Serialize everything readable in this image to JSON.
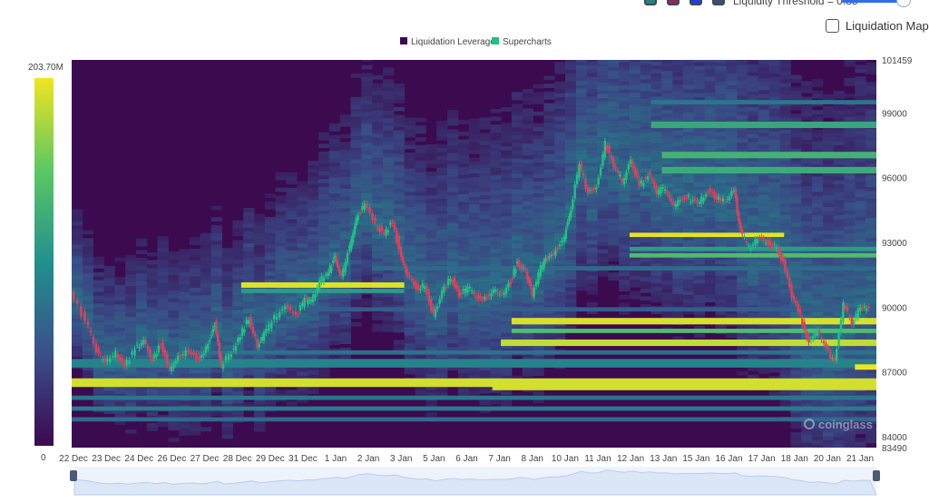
{
  "controls": {
    "threshold_label": "Liquidity Threshold = 0.85",
    "threshold_value": 0.85,
    "swatch_colors": [
      "#2f7f7a",
      "#8c2a5a",
      "#1f3fd8",
      "#3d4f6a"
    ],
    "liquidation_map_label": "Liquidation Map",
    "liquidation_map_checked": false
  },
  "chart_data": {
    "type": "heatmap",
    "legend": [
      {
        "name": "Liquidation Leverage",
        "color": "#3b0a4f"
      },
      {
        "name": "Supercharts",
        "color": "#22c184"
      }
    ],
    "colorbar": {
      "max_label": "203.70M",
      "min_label": "0",
      "max": 203700000,
      "min": 0,
      "colors": [
        "#3b0a4f",
        "#3a4f8a",
        "#21908d",
        "#5cc863",
        "#f0e51f"
      ]
    },
    "x_labels": [
      "22 Dec",
      "23 Dec",
      "24 Dec",
      "26 Dec",
      "27 Dec",
      "28 Dec",
      "29 Dec",
      "31 Dec",
      "1 Jan",
      "2 Jan",
      "3 Jan",
      "5 Jan",
      "6 Jan",
      "7 Jan",
      "8 Jan",
      "10 Jan",
      "11 Jan",
      "12 Jan",
      "13 Jan",
      "15 Jan",
      "16 Jan",
      "17 Jan",
      "18 Jan",
      "20 Jan",
      "21 Jan"
    ],
    "y_ticks": [
      99000,
      96000,
      93000,
      90000,
      87000,
      84000
    ],
    "y_max_label": "101459",
    "y_min_label": "83490",
    "ylim": [
      83490,
      101459
    ],
    "background_color": "#3b0a4f",
    "price_path": [
      [
        0,
        90600
      ],
      [
        0.7,
        89400
      ],
      [
        1.2,
        88000
      ],
      [
        1.6,
        87400
      ],
      [
        2.1,
        87900
      ],
      [
        2.5,
        87200
      ],
      [
        3.0,
        88100
      ],
      [
        3.4,
        88400
      ],
      [
        3.8,
        87600
      ],
      [
        4.2,
        88300
      ],
      [
        4.6,
        87100
      ],
      [
        5.0,
        87700
      ],
      [
        5.5,
        88000
      ],
      [
        6.0,
        87500
      ],
      [
        6.4,
        88300
      ],
      [
        6.7,
        89300
      ],
      [
        7.0,
        87300
      ],
      [
        7.5,
        87900
      ],
      [
        7.9,
        88700
      ],
      [
        8.3,
        89500
      ],
      [
        8.7,
        88200
      ],
      [
        9.0,
        88700
      ],
      [
        9.5,
        89500
      ],
      [
        10.0,
        90100
      ],
      [
        10.5,
        89600
      ],
      [
        10.9,
        90300
      ],
      [
        11.2,
        90200
      ],
      [
        11.6,
        91200
      ],
      [
        12.0,
        91600
      ],
      [
        12.3,
        92300
      ],
      [
        12.6,
        91400
      ],
      [
        13.0,
        92800
      ],
      [
        13.3,
        94100
      ],
      [
        13.7,
        94800
      ],
      [
        14.2,
        93800
      ],
      [
        14.6,
        93400
      ],
      [
        15.0,
        94000
      ],
      [
        15.4,
        92300
      ],
      [
        15.7,
        91500
      ],
      [
        16.1,
        90900
      ],
      [
        16.5,
        91000
      ],
      [
        16.9,
        89600
      ],
      [
        17.3,
        90700
      ],
      [
        17.7,
        91400
      ],
      [
        18.1,
        90600
      ],
      [
        18.5,
        90900
      ],
      [
        18.9,
        90500
      ],
      [
        19.3,
        90400
      ],
      [
        19.7,
        90700
      ],
      [
        20.1,
        90600
      ],
      [
        20.5,
        91200
      ],
      [
        20.8,
        92100
      ],
      [
        21.2,
        91600
      ],
      [
        21.5,
        90600
      ],
      [
        21.9,
        91800
      ],
      [
        22.2,
        92300
      ],
      [
        22.6,
        92600
      ],
      [
        23.0,
        93300
      ],
      [
        23.3,
        94600
      ],
      [
        23.7,
        96600
      ],
      [
        24.1,
        95300
      ],
      [
        24.5,
        95600
      ],
      [
        24.9,
        97600
      ],
      [
        25.3,
        96600
      ],
      [
        25.7,
        95800
      ],
      [
        26.1,
        96800
      ],
      [
        26.5,
        95600
      ],
      [
        26.9,
        96200
      ],
      [
        27.3,
        95300
      ],
      [
        27.7,
        95500
      ],
      [
        28.1,
        94700
      ],
      [
        28.5,
        95100
      ],
      [
        28.9,
        95000
      ],
      [
        29.3,
        94900
      ],
      [
        29.7,
        95400
      ],
      [
        30.1,
        95100
      ],
      [
        30.5,
        94900
      ],
      [
        30.9,
        95500
      ],
      [
        31.2,
        93500
      ],
      [
        31.6,
        92800
      ],
      [
        32.0,
        93200
      ],
      [
        32.4,
        93000
      ],
      [
        32.8,
        92800
      ],
      [
        33.2,
        92100
      ],
      [
        33.6,
        90500
      ],
      [
        34.0,
        89600
      ],
      [
        34.4,
        88400
      ],
      [
        34.8,
        88900
      ],
      [
        35.2,
        88100
      ],
      [
        35.6,
        87400
      ],
      [
        36.0,
        90100
      ],
      [
        36.4,
        89300
      ],
      [
        36.8,
        90000
      ],
      [
        37.2,
        89900
      ]
    ],
    "liquidation_bands": [
      {
        "x0": 0,
        "x1": 37.5,
        "y0": 86300,
        "y1": 86700,
        "level": 0.95
      },
      {
        "x0": 0,
        "x1": 37.5,
        "y0": 87200,
        "y1": 87600,
        "level": 0.45
      },
      {
        "x0": 19.6,
        "x1": 37.5,
        "y0": 86150,
        "y1": 86350,
        "level": 0.95
      },
      {
        "x0": 20.0,
        "x1": 37.5,
        "y0": 88200,
        "y1": 88500,
        "level": 0.92
      },
      {
        "x0": 20.5,
        "x1": 37.5,
        "y0": 89200,
        "y1": 89500,
        "level": 0.96
      },
      {
        "x0": 20.5,
        "x1": 37.5,
        "y0": 88800,
        "y1": 89000,
        "level": 0.7
      },
      {
        "x0": 7.9,
        "x1": 15.5,
        "y0": 90900,
        "y1": 91150,
        "level": 0.97
      },
      {
        "x0": 7.9,
        "x1": 15.5,
        "y0": 90650,
        "y1": 90850,
        "level": 0.55
      },
      {
        "x0": 26.0,
        "x1": 33.2,
        "y0": 93250,
        "y1": 93450,
        "level": 0.98
      },
      {
        "x0": 26.0,
        "x1": 37.5,
        "y0": 92600,
        "y1": 92800,
        "level": 0.55
      },
      {
        "x0": 26.0,
        "x1": 37.5,
        "y0": 92300,
        "y1": 92500,
        "level": 0.7
      },
      {
        "x0": 27.5,
        "x1": 37.5,
        "y0": 96200,
        "y1": 96500,
        "level": 0.62
      },
      {
        "x0": 27.5,
        "x1": 37.5,
        "y0": 96900,
        "y1": 97200,
        "level": 0.65
      },
      {
        "x0": 27.0,
        "x1": 37.5,
        "y0": 98300,
        "y1": 98600,
        "level": 0.6
      },
      {
        "x0": 27.0,
        "x1": 37.5,
        "y0": 99400,
        "y1": 99600,
        "level": 0.4
      },
      {
        "x0": 0,
        "x1": 37.5,
        "y0": 85200,
        "y1": 85400,
        "level": 0.42
      },
      {
        "x0": 0,
        "x1": 37.5,
        "y0": 84700,
        "y1": 84900,
        "level": 0.35
      },
      {
        "x0": 0,
        "x1": 37.5,
        "y0": 85700,
        "y1": 85900,
        "level": 0.4
      },
      {
        "x0": 5.0,
        "x1": 37.5,
        "y0": 87800,
        "y1": 88000,
        "level": 0.38
      },
      {
        "x0": 11.0,
        "x1": 37.5,
        "y0": 89800,
        "y1": 90000,
        "level": 0.3
      },
      {
        "x0": 14.0,
        "x1": 37.5,
        "y0": 91700,
        "y1": 91900,
        "level": 0.35
      },
      {
        "x0": 36.5,
        "x1": 37.5,
        "y0": 87100,
        "y1": 87350,
        "level": 1.0
      }
    ],
    "watermark": "coinglass"
  }
}
